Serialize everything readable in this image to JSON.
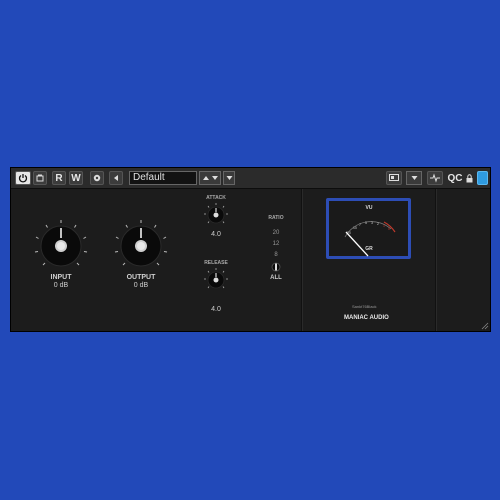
{
  "toolbar": {
    "power_icon": "power-icon",
    "compare_icon": "ab-compare-icon",
    "read_label": "R",
    "write_label": "W",
    "preset_name": "Default",
    "qc_label": "QC",
    "colors": {
      "accent": "#2f9be0",
      "active": "#e6e6e6"
    }
  },
  "controls": {
    "input": {
      "label": "INPUT",
      "value": "0 dB"
    },
    "output": {
      "label": "OUTPUT",
      "value": "0 dB"
    },
    "attack": {
      "label": "ATTACK",
      "value": "4.0"
    },
    "release": {
      "label": "RELEASE",
      "value": "4.0"
    },
    "ratio": {
      "label": "RATIO",
      "options": [
        "20",
        "12",
        "8",
        "4",
        "ALL"
      ],
      "selected": "ALL"
    }
  },
  "meter": {
    "top_label": "VU",
    "bottom_label": "GR",
    "scale": [
      "20",
      "10",
      "7",
      "5",
      "3",
      "2",
      "1",
      "0"
    ],
    "colors": {
      "frame": "#2d4db5",
      "needle": "#ffffff",
      "red_zone": "#c0392b"
    }
  },
  "branding": {
    "model": "Sankt76Black",
    "company": "MANIAC AUDIO"
  }
}
